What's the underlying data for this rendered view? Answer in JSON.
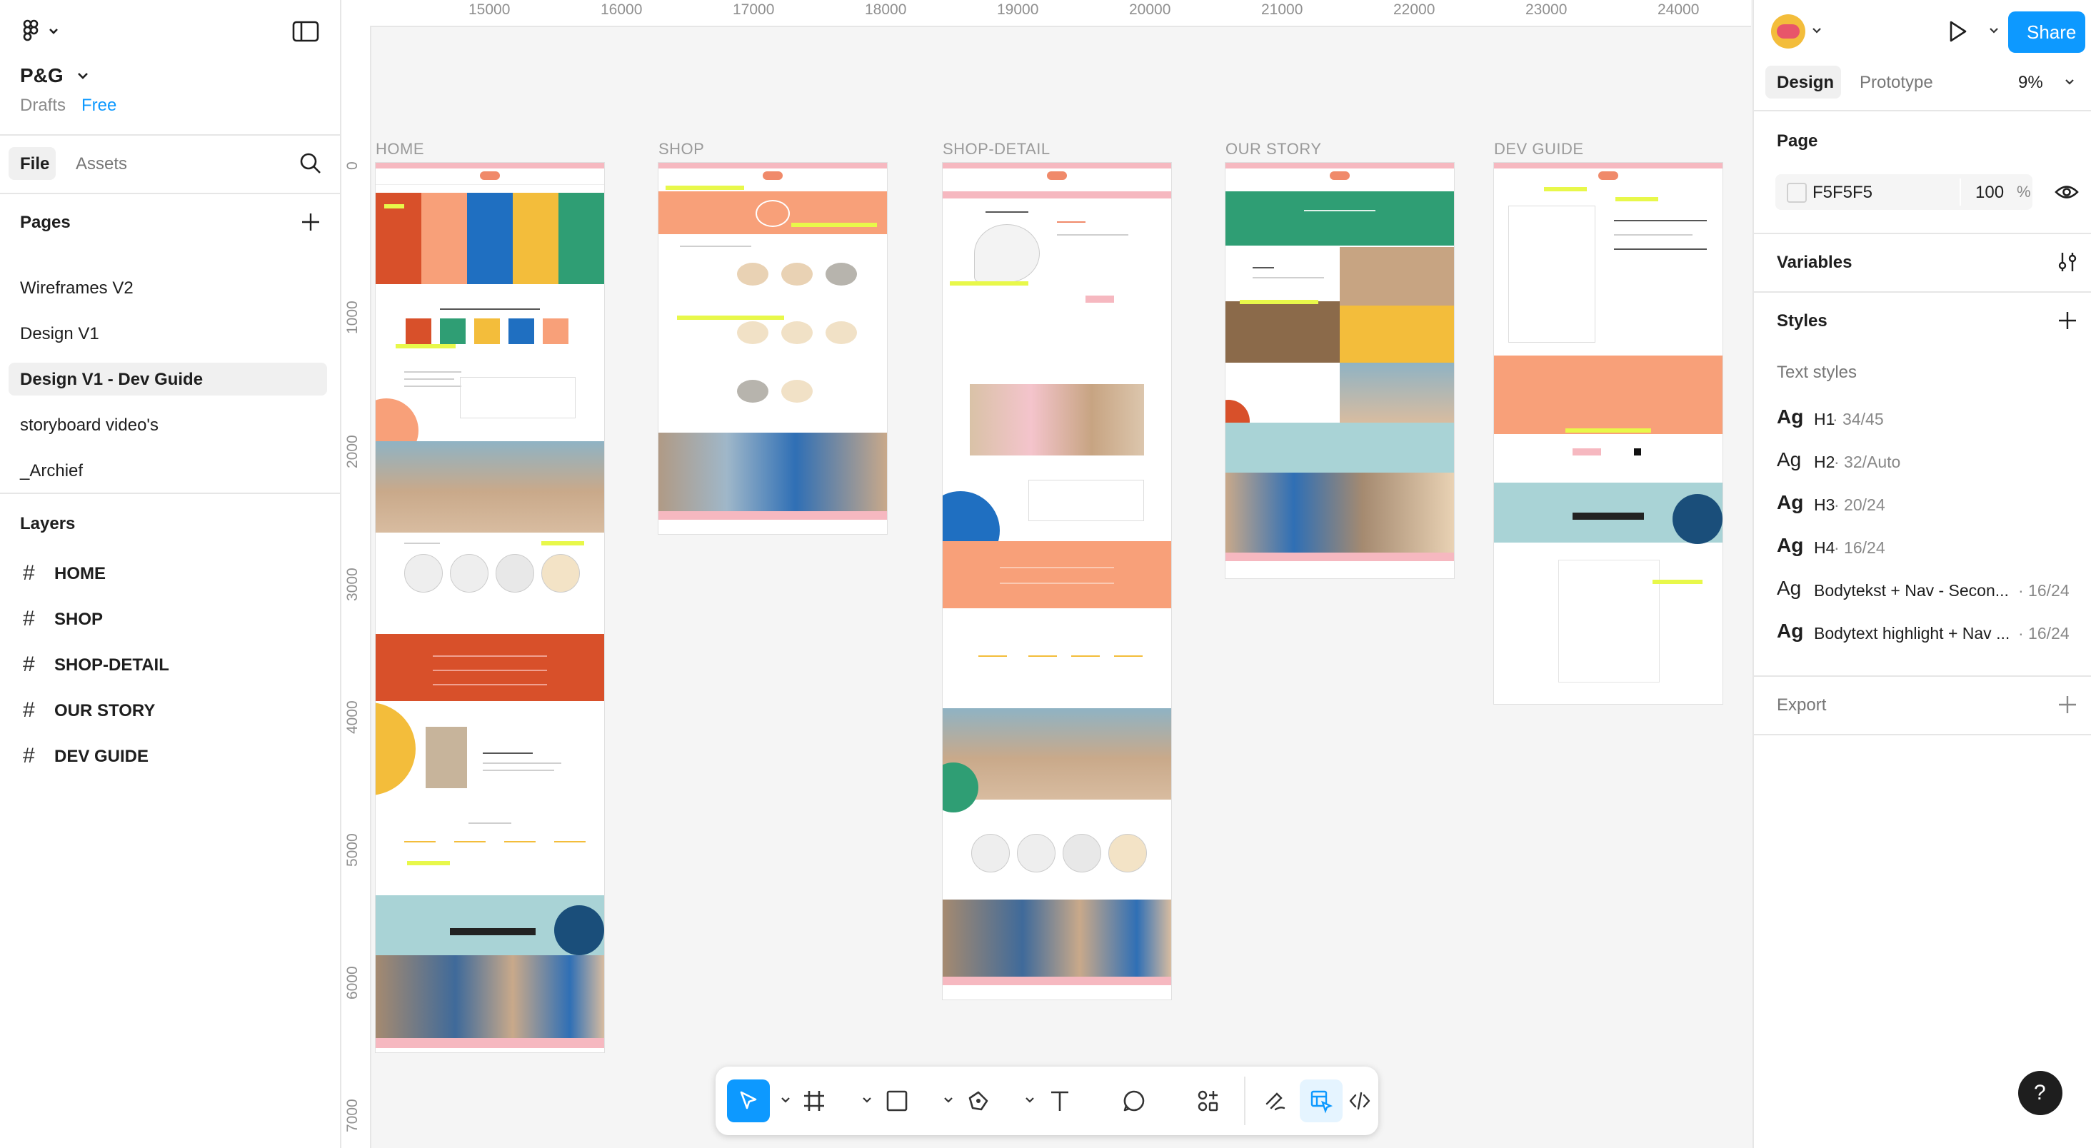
{
  "app": {
    "file_name": "P&G",
    "drafts_label": "Drafts",
    "plan_label": "Free"
  },
  "sidebar": {
    "tabs": [
      {
        "label": "File"
      },
      {
        "label": "Assets"
      }
    ],
    "pages_heading": "Pages",
    "pages": [
      {
        "label": "Wireframes V2"
      },
      {
        "label": "Design V1"
      },
      {
        "label": "Design V1 - Dev Guide"
      },
      {
        "label": "storyboard video's"
      },
      {
        "label": "_Archief"
      }
    ],
    "layers_heading": "Layers",
    "layers": [
      {
        "label": "HOME"
      },
      {
        "label": "SHOP"
      },
      {
        "label": "SHOP-DETAIL"
      },
      {
        "label": "OUR STORY"
      },
      {
        "label": "DEV GUIDE"
      }
    ]
  },
  "canvas": {
    "ruler_x": [
      "15000",
      "16000",
      "17000",
      "18000",
      "19000",
      "20000",
      "21000",
      "22000",
      "23000",
      "24000"
    ],
    "ruler_y": [
      "0",
      "1000",
      "2000",
      "3000",
      "4000",
      "5000",
      "6000",
      "7000"
    ],
    "frames": [
      {
        "label": "HOME"
      },
      {
        "label": "SHOP"
      },
      {
        "label": "SHOP-DETAIL"
      },
      {
        "label": "OUR STORY"
      },
      {
        "label": "DEV GUIDE"
      }
    ],
    "brand_colors": {
      "red": "#d8502a",
      "peach": "#f8a079",
      "blue": "#1f6fc1",
      "yellow": "#f3bd3b",
      "green": "#2f9e74",
      "teal": "#a9d3d6",
      "pink": "#f6b8c0"
    }
  },
  "right_panel": {
    "tabs": [
      {
        "label": "Design"
      },
      {
        "label": "Prototype"
      }
    ],
    "zoom": "9%",
    "share_label": "Share",
    "page_heading": "Page",
    "page_color": "F5F5F5",
    "page_opacity": "100",
    "page_opacity_unit": "%",
    "variables_heading": "Variables",
    "styles_heading": "Styles",
    "text_styles_heading": "Text styles",
    "text_styles": [
      {
        "ag": "Ag",
        "name": "H1",
        "spec": " · 34/45",
        "weight": "bold"
      },
      {
        "ag": "Ag",
        "name": "H2",
        "spec": " · 32/Auto",
        "weight": "normal"
      },
      {
        "ag": "Ag",
        "name": "H3",
        "spec": " · 20/24",
        "weight": "bold"
      },
      {
        "ag": "Ag",
        "name": "H4",
        "spec": " · 16/24",
        "weight": "bold"
      },
      {
        "ag": "Ag",
        "name": "Bodytekst + Nav - Secon...",
        "spec": " · 16/24",
        "weight": "normal"
      },
      {
        "ag": "Ag",
        "name": "Bodytext highlight + Nav ...",
        "spec": " · 16/24",
        "weight": "bold"
      }
    ],
    "export_heading": "Export"
  },
  "help_label": "?"
}
